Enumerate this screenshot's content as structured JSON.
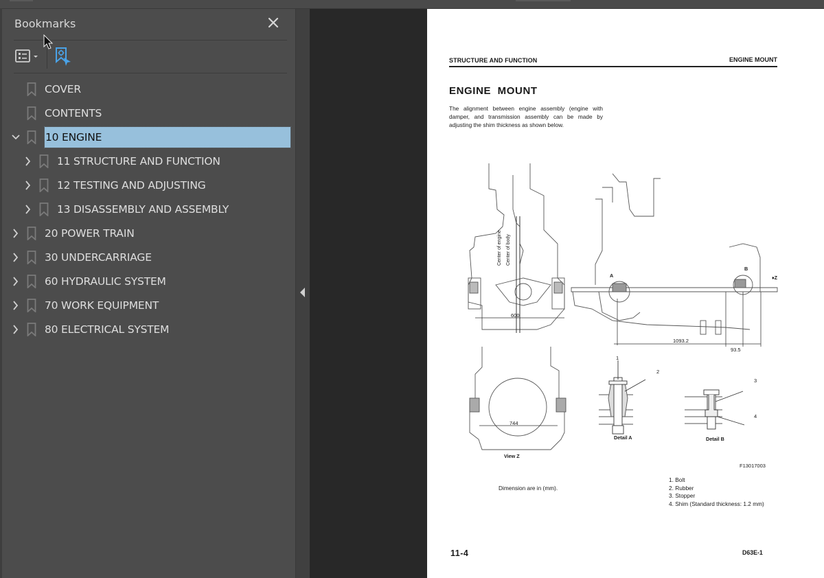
{
  "sidebar": {
    "title": "Bookmarks",
    "close_icon": "close-icon",
    "toolbar": {
      "options_icon": "list-options-icon",
      "find_current_icon": "find-current-bookmark-icon"
    },
    "items": [
      {
        "label": "COVER",
        "level": 0,
        "expander": "none",
        "selected": false
      },
      {
        "label": "CONTENTS",
        "level": 0,
        "expander": "none",
        "selected": false
      },
      {
        "label": "10 ENGINE",
        "level": 0,
        "expander": "expanded",
        "selected": true
      },
      {
        "label": "11 STRUCTURE AND FUNCTION",
        "level": 1,
        "expander": "collapsed",
        "selected": false
      },
      {
        "label": "12 TESTING AND ADJUSTING",
        "level": 1,
        "expander": "collapsed",
        "selected": false
      },
      {
        "label": "13 DISASSEMBLY AND ASSEMBLY",
        "level": 1,
        "expander": "collapsed",
        "selected": false
      },
      {
        "label": "20 POWER TRAIN",
        "level": 0,
        "expander": "collapsed",
        "selected": false
      },
      {
        "label": "30 UNDERCARRIAGE",
        "level": 0,
        "expander": "collapsed",
        "selected": false
      },
      {
        "label": "60 HYDRAULIC SYSTEM",
        "level": 0,
        "expander": "collapsed",
        "selected": false
      },
      {
        "label": "70 WORK EQUIPMENT",
        "level": 0,
        "expander": "collapsed",
        "selected": false
      },
      {
        "label": "80 ELECTRICAL SYSTEM",
        "level": 0,
        "expander": "collapsed",
        "selected": false
      }
    ],
    "selection_color": "#97c0dc"
  },
  "collapse_handle_icon": "collapse-left-arrow-icon",
  "document_page": {
    "header_left": "STRUCTURE AND FUNCTION",
    "header_right": "ENGINE MOUNT",
    "title": "ENGINE  MOUNT",
    "intro": "The alignment between engine assembly (engine with damper, and transmission assembly can be made by adjusting the shim thickness as shown below.",
    "drawing": {
      "center_engine_label": "Center of engine",
      "center_body_label": "Center of body",
      "dim_600": "600",
      "dim_1093": "1093.2",
      "dim_93": "93.5",
      "dim_744": "744",
      "marker_a": "A",
      "marker_b": "B",
      "marker_z": "Z",
      "view_z": "View Z",
      "detail_a": "Detail A",
      "detail_b": "Detail B",
      "callouts": [
        "1",
        "2",
        "3",
        "4"
      ]
    },
    "figure_id": "F13017003",
    "dimension_note": "Dimension are in (mm).",
    "legend": [
      "1.  Bolt",
      "2.  Rubber",
      "3.  Stopper",
      "4.  Shim (Standard thickness: 1.2 mm)"
    ],
    "page_number": "11-4",
    "model": "D63E-1"
  }
}
